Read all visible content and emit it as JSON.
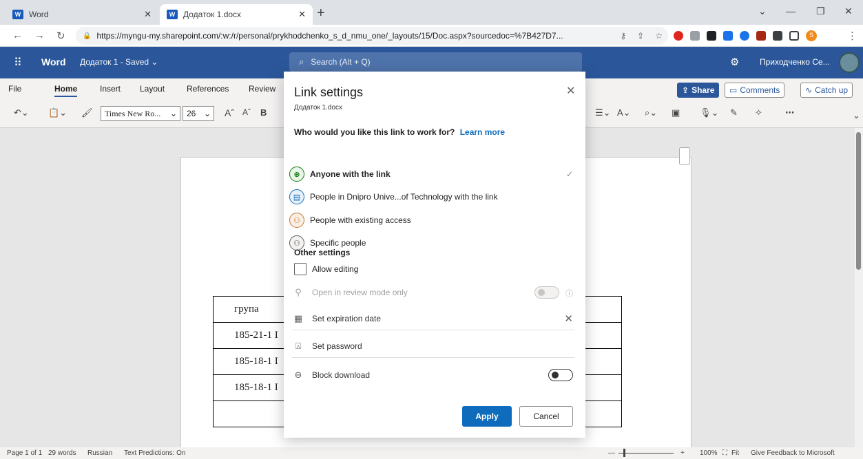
{
  "browser": {
    "tabs": [
      {
        "label": "Word",
        "favicon": "W"
      },
      {
        "label": "Додаток 1.docx",
        "favicon": "W"
      }
    ],
    "url": "https://myngu-my.sharepoint.com/:w:/r/personal/prykhodchenko_s_d_nmu_one/_layouts/15/Doc.aspx?sourcedoc=%7B427D7...",
    "profile_initial": "S"
  },
  "app": {
    "name": "Word",
    "doc_name": "Додаток 1 - Saved ⌄",
    "search_placeholder": "Search (Alt + Q)",
    "user": "Приходченко Се..."
  },
  "ribbon": {
    "tabs": [
      "File",
      "Home",
      "Insert",
      "Layout",
      "References",
      "Review"
    ],
    "active_tab": "Home",
    "font": "Times New Ro...",
    "font_size": "26",
    "share": "Share",
    "comments": "Comments",
    "catch_up": "Catch up"
  },
  "document": {
    "table": [
      [
        "група",
        ""
      ],
      [
        "185-21-1 І",
        ""
      ],
      [
        "185-18-1 І",
        ""
      ],
      [
        "185-18-1 І",
        ""
      ],
      [
        "",
        ""
      ]
    ]
  },
  "status": {
    "page": "Page 1 of 1",
    "words": "29 words",
    "language": "Russian",
    "predictions": "Text Predictions: On",
    "zoom": "100%",
    "fit": "Fit",
    "feedback": "Give Feedback to Microsoft"
  },
  "dialog": {
    "title": "Link settings",
    "subtitle": "Додаток 1.docx",
    "question": "Who would you like this link to work for?",
    "learn_more": "Learn more",
    "options": [
      {
        "label": "Anyone with the link",
        "icon": "globe-icon",
        "selected": true
      },
      {
        "label": "People in Dnipro Unive...of Technology with the link",
        "icon": "building-icon",
        "selected": false
      },
      {
        "label": "People with existing access",
        "icon": "people-icon",
        "selected": false
      },
      {
        "label": "Specific people",
        "icon": "person-icon",
        "selected": false
      }
    ],
    "other_settings": "Other settings",
    "allow_editing": "Allow editing",
    "review_mode": "Open in review mode only",
    "expiration": "Set expiration date",
    "password": "Set password",
    "block_download": "Block download",
    "apply": "Apply",
    "cancel": "Cancel"
  },
  "colors": {
    "word_blue": "#2b579a",
    "apply_blue": "#0f6cbd"
  }
}
